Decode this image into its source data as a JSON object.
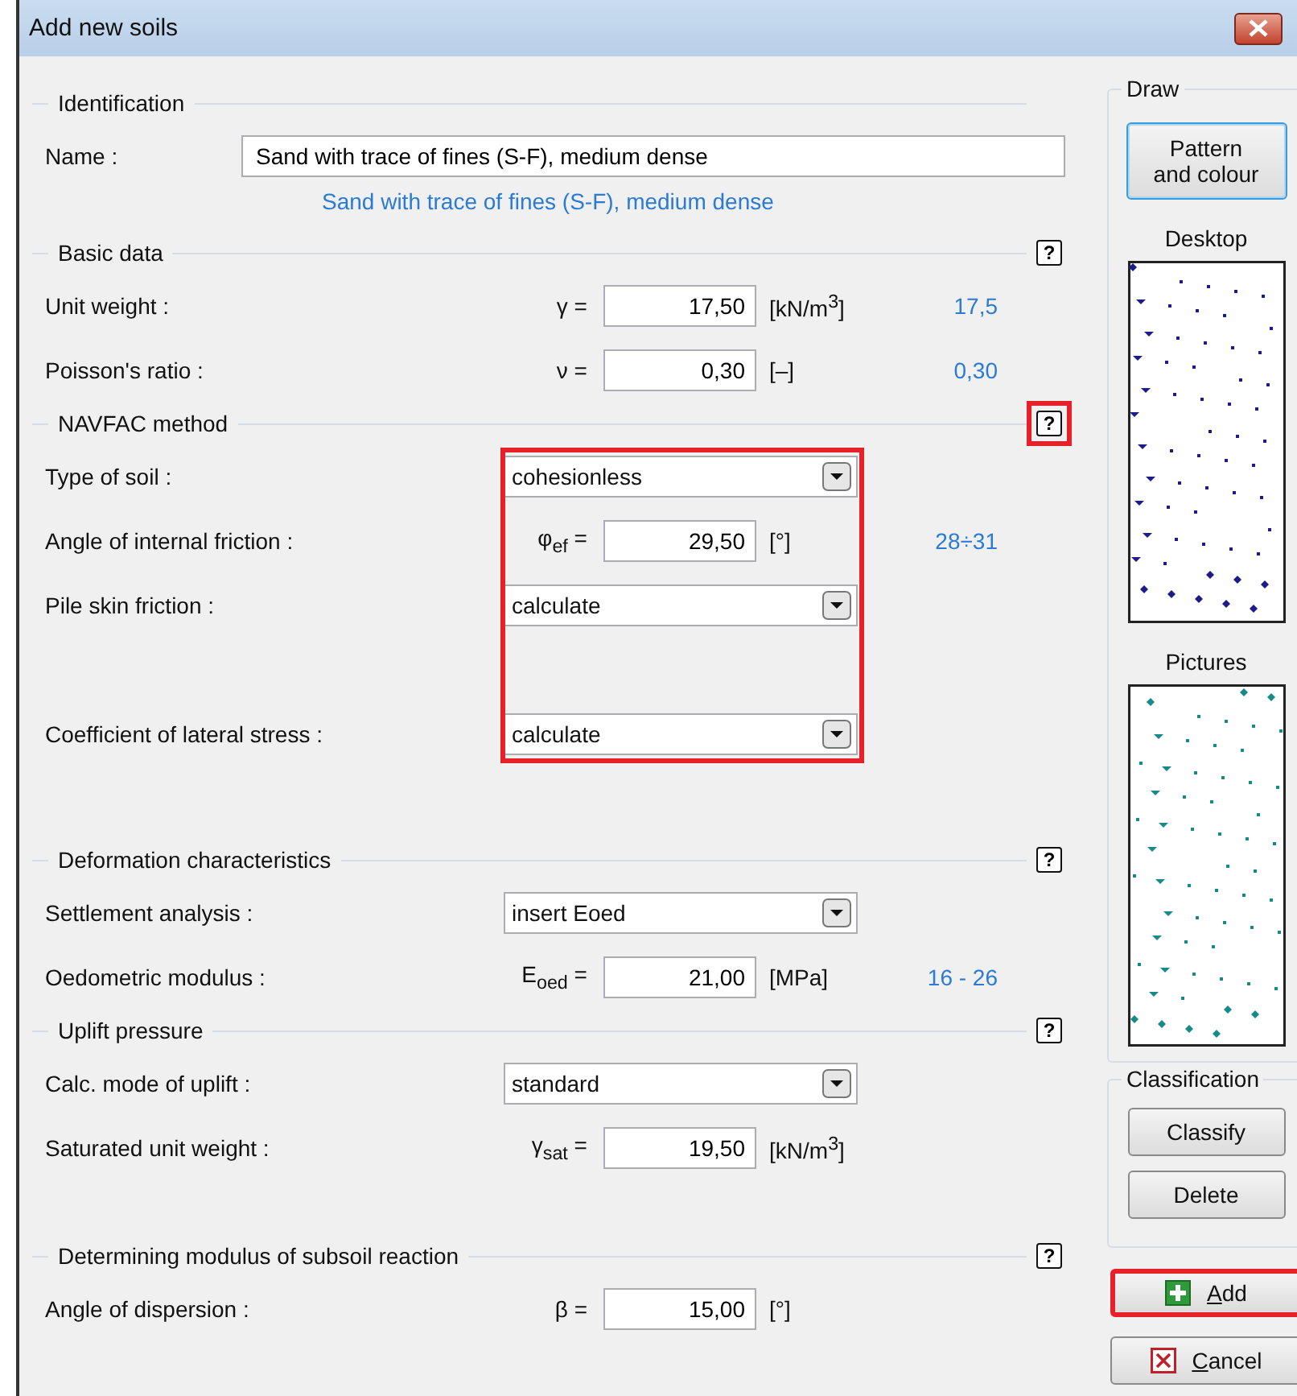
{
  "window": {
    "title": "Add new soils"
  },
  "sections": [
    {
      "title": "Identification",
      "rows": [
        {
          "kind": "text",
          "label": "Name :",
          "value": "Sand with trace of fines (S-F), medium dense"
        },
        {
          "kind": "note",
          "text": "Sand with trace of fines (S-F), medium dense"
        }
      ]
    },
    {
      "title": "Basic data",
      "help": "?",
      "rows": [
        {
          "kind": "number",
          "label": "Unit weight :",
          "symbol": "γ =",
          "value": "17,50",
          "unit": "[kN/m$^{3}$]",
          "hint": "17,5"
        },
        {
          "kind": "number",
          "label": "Poisson's ratio :",
          "symbol": "ν =",
          "value": "0,30",
          "unit": "[–]",
          "hint": "0,30"
        }
      ]
    },
    {
      "title": "NAVFAC method",
      "help": "?",
      "help_highlighted": true,
      "fields_highlighted": true,
      "rows": [
        {
          "kind": "select",
          "label": "Type of soil :",
          "value": "cohesionless"
        },
        {
          "kind": "number",
          "label": "Angle of internal friction :",
          "symbol": "φ$_{ef}$ =",
          "value": "29,50",
          "unit": "[°]",
          "hint": "28÷31"
        },
        {
          "kind": "select",
          "label": "Pile skin friction  :",
          "value": "calculate"
        },
        {
          "kind": "select",
          "label": "Coefficient of lateral stress  :",
          "value": "calculate"
        }
      ]
    },
    {
      "title": "Deformation characteristics",
      "help": "?",
      "rows": [
        {
          "kind": "select",
          "label": "Settlement analysis :",
          "value": "insert Eoed"
        },
        {
          "kind": "number",
          "label": "Oedometric modulus :",
          "symbol": "E$_{oed}$ =",
          "value": "21,00",
          "unit": "[MPa]",
          "hint": "16 - 26"
        }
      ]
    },
    {
      "title": "Uplift pressure",
      "help": "?",
      "rows": [
        {
          "kind": "select",
          "label": "Calc. mode of uplift :",
          "value": "standard"
        },
        {
          "kind": "number",
          "label": "Saturated unit weight :",
          "symbol": "γ$_{sat}$ =",
          "value": "19,50",
          "unit": "[kN/m$^{3}$]"
        }
      ]
    },
    {
      "title": "Determining modulus of subsoil reaction",
      "help": "?",
      "rows": [
        {
          "kind": "number",
          "label": "Angle of dispersion :",
          "symbol": "β =",
          "value": "15,00",
          "unit": "[°]"
        }
      ]
    }
  ],
  "side": {
    "draw": {
      "title": "Draw",
      "button": "Pattern and colour",
      "previews": [
        {
          "title": "Desktop",
          "color": "#1c1c8a"
        },
        {
          "title": "Pictures",
          "color": "#178a8a"
        }
      ]
    },
    "classification": {
      "title": "Classification",
      "buttons": [
        "Classify",
        "Delete"
      ]
    }
  },
  "actions": [
    {
      "kind": "add",
      "label": "Add",
      "highlighted": true
    },
    {
      "kind": "cancel",
      "label": "Cancel",
      "highlighted": false
    }
  ]
}
